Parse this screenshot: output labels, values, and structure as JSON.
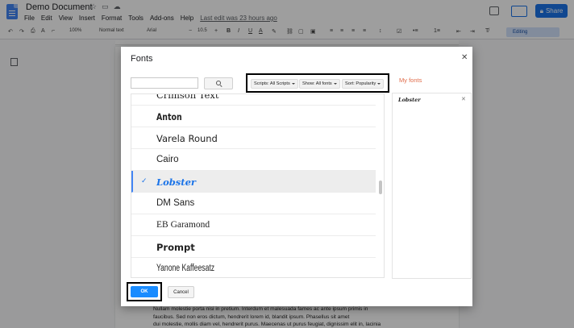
{
  "app": {
    "title": "Demo Document",
    "menus": [
      "File",
      "Edit",
      "View",
      "Insert",
      "Format",
      "Tools",
      "Add-ons",
      "Help"
    ],
    "last_edit": "Last edit was 23 hours ago",
    "share_label": "Share",
    "accent": "#1a73e8"
  },
  "toolbar": {
    "zoom": "100%",
    "style": "Normal text",
    "font": "Arial",
    "font_size": "10.5",
    "mode": "Editing"
  },
  "document": {
    "lines": [
      "Nullam molestie porta nisi in pretium. Interdum et malesuada fames ac ante ipsum primis in",
      "faucibus. Sed non eros dictum, hendrerit lorem id, blandit ipsum. Phasellus sit amet",
      "dui molestie, mollis diam vel, hendrerit purus. Maecenas ut purus feugiat, dignissim elit in, lacinia"
    ]
  },
  "dialog": {
    "title": "Fonts",
    "search": {
      "value": "",
      "placeholder": ""
    },
    "filters": {
      "scripts": "Scripts: All Scripts",
      "show": "Show: All fonts",
      "sort": "Sort: Popularity"
    },
    "fonts": [
      {
        "name": "Crimson Text",
        "selected": false
      },
      {
        "name": "Anton",
        "selected": false
      },
      {
        "name": "Varela Round",
        "selected": false
      },
      {
        "name": "Cairo",
        "selected": false
      },
      {
        "name": "Lobster",
        "selected": true
      },
      {
        "name": "DM Sans",
        "selected": false
      },
      {
        "name": "EB Garamond",
        "selected": false
      },
      {
        "name": "Prompt",
        "selected": false
      },
      {
        "name": "Yanone Kaffeesatz",
        "selected": false
      }
    ],
    "my_fonts": {
      "title": "My fonts",
      "items": [
        "Lobster"
      ]
    },
    "ok_label": "OK",
    "cancel_label": "Cancel",
    "title_color": "#e06c4a"
  }
}
